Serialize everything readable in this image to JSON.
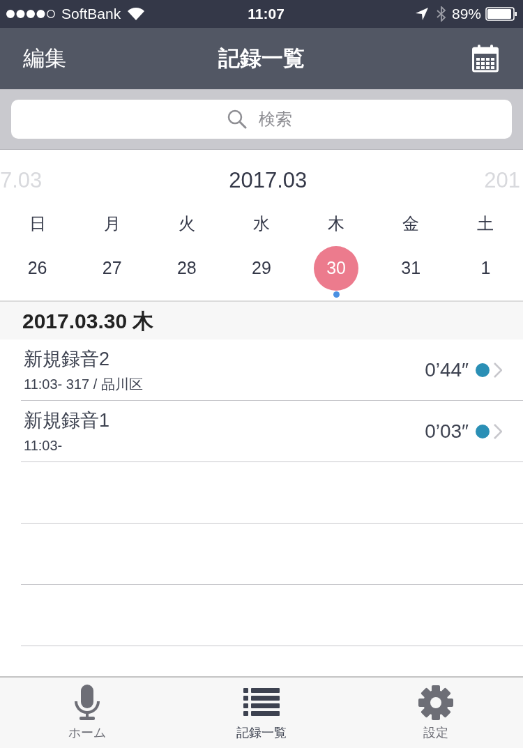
{
  "status_bar": {
    "carrier": "SoftBank",
    "time": "11:07",
    "battery": "89%"
  },
  "nav": {
    "left": "編集",
    "title": "記録一覧"
  },
  "search": {
    "placeholder": "検索"
  },
  "calendar": {
    "prev_month": "7.03",
    "month": "2017.03",
    "next_month": "201",
    "weekdays": [
      "日",
      "月",
      "火",
      "水",
      "木",
      "金",
      "土"
    ],
    "days": [
      {
        "label": "26",
        "selected": false,
        "has_record": false
      },
      {
        "label": "27",
        "selected": false,
        "has_record": false
      },
      {
        "label": "28",
        "selected": false,
        "has_record": false
      },
      {
        "label": "29",
        "selected": false,
        "has_record": false
      },
      {
        "label": "30",
        "selected": true,
        "has_record": true
      },
      {
        "label": "31",
        "selected": false,
        "has_record": false
      },
      {
        "label": "1",
        "selected": false,
        "has_record": false
      }
    ]
  },
  "section": {
    "date": "2017.03.30 木"
  },
  "recordings": [
    {
      "title": "新規録音2",
      "detail": "11:03- 317 / 品川区",
      "duration": "0’44″"
    },
    {
      "title": "新規録音1",
      "detail": "11:03-",
      "duration": "0’03″"
    }
  ],
  "tab_bar": [
    {
      "label": "ホーム",
      "kind": "mic",
      "selected": false
    },
    {
      "label": "記録一覧",
      "kind": "list",
      "selected": true
    },
    {
      "label": "設定",
      "kind": "gear",
      "selected": false
    }
  ]
}
